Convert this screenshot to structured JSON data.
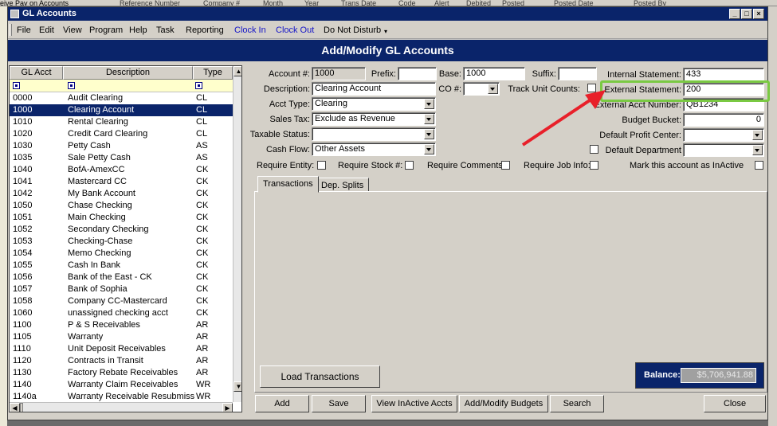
{
  "background_app": {
    "top_strip_text": "eive Pay on Accounts",
    "header_fragments": [
      "Reference Number",
      "Company #",
      "Month",
      "Year",
      "Trans Date",
      "Code",
      "Alert",
      "Debited",
      "Posted",
      "Posted Date",
      "Posted By"
    ]
  },
  "window": {
    "title": "GL Accounts"
  },
  "menu": {
    "items": [
      "File",
      "Edit",
      "View",
      "Program",
      "Help",
      "Task",
      "Reporting"
    ],
    "clock_in": "Clock In",
    "clock_out": "Clock Out",
    "dnd": "Do Not Disturb"
  },
  "header": {
    "title": "Add/Modify GL Accounts"
  },
  "grid": {
    "columns": [
      "GL Acct",
      "Description",
      "Type"
    ],
    "selected_index": 1,
    "rows": [
      [
        "0000",
        "Audit Clearing",
        "CL"
      ],
      [
        "1000",
        "Clearing Account",
        "CL"
      ],
      [
        "1010",
        "Rental Clearing",
        "CL"
      ],
      [
        "1020",
        "Credit Card Clearing",
        "CL"
      ],
      [
        "1030",
        "Petty Cash",
        "AS"
      ],
      [
        "1035",
        "Sale Petty Cash",
        "AS"
      ],
      [
        "1040",
        "BofA-AmexCC",
        "CK"
      ],
      [
        "1041",
        "Mastercard CC",
        "CK"
      ],
      [
        "1042",
        "My Bank Account",
        "CK"
      ],
      [
        "1050",
        "Chase Checking",
        "CK"
      ],
      [
        "1051",
        "Main Checking",
        "CK"
      ],
      [
        "1052",
        "Secondary Checking",
        "CK"
      ],
      [
        "1053",
        "Checking-Chase",
        "CK"
      ],
      [
        "1054",
        "Memo Checking",
        "CK"
      ],
      [
        "1055",
        "Cash In Bank",
        "CK"
      ],
      [
        "1056",
        "Bank of the East - CK",
        "CK"
      ],
      [
        "1057",
        "Bank of Sophia",
        "CK"
      ],
      [
        "1058",
        "Company CC-Mastercard",
        "CK"
      ],
      [
        "1060",
        "unassigned checking acct",
        "CK"
      ],
      [
        "1100",
        "P & S Receivables",
        "AR"
      ],
      [
        "1105",
        "Warranty",
        "AR"
      ],
      [
        "1110",
        "Unit Deposit Receivables",
        "AR"
      ],
      [
        "1120",
        "Contracts in Transit",
        "AR"
      ],
      [
        "1130",
        "Factory Rebate Receivables",
        "AR"
      ],
      [
        "1140",
        "Warranty Claim Receivables",
        "WR"
      ],
      [
        "1140a",
        "Warranty Receivable Resubmiss",
        "WR"
      ]
    ]
  },
  "form": {
    "account_label": "Account #:",
    "account_value": "1000",
    "prefix_label": "Prefix:",
    "prefix_value": "",
    "base_label": "Base:",
    "base_value": "1000",
    "suffix_label": "Suffix:",
    "suffix_value": "",
    "internal_label": "Internal Statement:",
    "internal_value": "433",
    "description_label": "Description:",
    "description_value": "Clearing Account",
    "co_label": "CO #:",
    "co_value": "",
    "track_label": "Track Unit Counts:",
    "external_label": "External Statement:",
    "external_value": "200",
    "acct_type_label": "Acct Type:",
    "acct_type_value": "Clearing",
    "ext_acct_label": "External Acct Number:",
    "ext_acct_value": "QB1234",
    "sales_tax_label": "Sales Tax:",
    "sales_tax_value": "Exclude as Revenue",
    "budget_label": "Budget Bucket:",
    "budget_value": "0",
    "taxable_label": "Taxable Status:",
    "taxable_value": "",
    "profit_center_label": "Default Profit Center:",
    "profit_center_value": "",
    "cash_flow_label": "Cash Flow:",
    "cash_flow_value": "Other Assets",
    "dept_label": "Default Department",
    "dept_value": "",
    "req_entity_label": "Require Entity:",
    "req_stock_label": "Require Stock #:",
    "req_comments_label": "Require Comments:",
    "req_job_label": "Require Job Info:",
    "inactive_label": "Mark this account as InActive"
  },
  "tabs": [
    "Transactions",
    "Dep. Splits"
  ],
  "load_button": "Load Transactions",
  "balance": {
    "label": "Balance:",
    "value": "$5,706,941.88"
  },
  "buttons": {
    "add": "Add",
    "save": "Save",
    "view_inactive": "View InActive Accts",
    "budgets": "Add/Modify Budgets",
    "search": "Search",
    "close": "Close"
  },
  "annotation": {
    "highlight_color": "#7ac943",
    "arrow_color": "#e8202a"
  }
}
